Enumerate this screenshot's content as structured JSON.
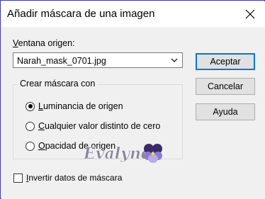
{
  "window": {
    "title": "Añadir máscara de una imagen"
  },
  "source": {
    "label_accel": "V",
    "label_rest": "entana origen:",
    "selected": "Narah_mask_0701.jpg"
  },
  "buttons": {
    "ok": "Aceptar",
    "cancel": "Cancelar",
    "help": "Ayuda"
  },
  "mask_group": {
    "label": "Crear máscara con",
    "options": [
      {
        "accel": "L",
        "rest": "uminancia de origen",
        "checked": true
      },
      {
        "accel": "C",
        "rest": "ualquier valor distinto de cero",
        "checked": false
      },
      {
        "accel": "O",
        "rest": "pacidad de origen",
        "checked": false
      }
    ]
  },
  "invert": {
    "accel": "I",
    "rest": "nvertir datos de máscara",
    "checked": false
  },
  "watermark": {
    "text": "Evalynda"
  },
  "icons": {
    "close": "close-icon",
    "dropdown": "chevron-down-icon",
    "watermark": "pansy-flower-icon"
  },
  "colors": {
    "accent": "#0078d7",
    "frame": "#3f3fb4",
    "dialog_bg": "#f0f0f0"
  }
}
